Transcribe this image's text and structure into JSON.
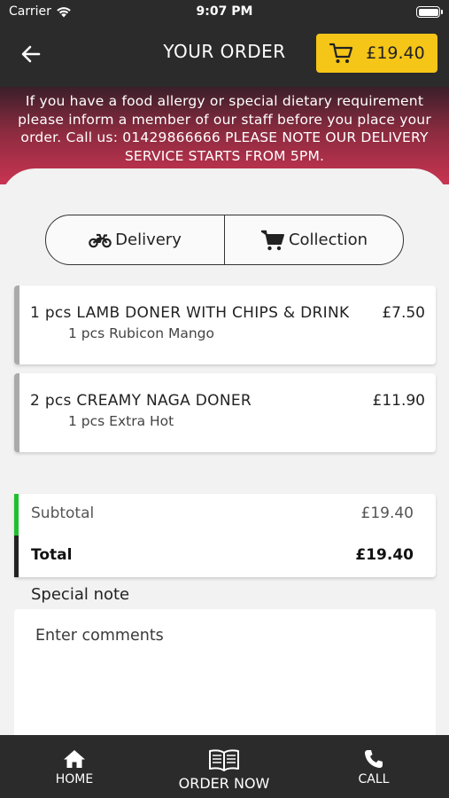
{
  "status_bar": {
    "carrier": "Carrier",
    "time": "9:07 PM"
  },
  "header": {
    "title": "YOUR ORDER",
    "cart_total": "£19.40",
    "back_icon": "arrow-left-icon",
    "cart_icon": "cart-icon"
  },
  "banner": {
    "text": "If you have a food allergy or special dietary requirement please inform a member of our staff before you place your order. Call us: 01429866666 PLEASE NOTE OUR DELIVERY SERVICE STARTS FROM 5PM."
  },
  "order_type": {
    "options": [
      {
        "label": "Delivery",
        "icon": "motorbike-icon"
      },
      {
        "label": "Collection",
        "icon": "cart-icon"
      }
    ]
  },
  "items": [
    {
      "name": "1 pcs LAMB DONER WITH CHIPS & DRINK",
      "price": "£7.50",
      "modifier": "1 pcs Rubicon Mango"
    },
    {
      "name": "2 pcs CREAMY NAGA DONER",
      "price": "£11.90",
      "modifier": "1 pcs Extra  Hot"
    }
  ],
  "totals": {
    "subtotal_label": "Subtotal",
    "subtotal_value": "£19.40",
    "total_label": "Total",
    "total_value": "£19.40"
  },
  "note": {
    "label": "Special note",
    "placeholder": "Enter comments"
  },
  "tabbar": {
    "home": "HOME",
    "order": "ORDER NOW",
    "call": "CALL"
  },
  "colors": {
    "header_bg": "#2b2b2b",
    "accent": "#f5c518",
    "subtotal_bar": "#1fbf2f",
    "banner_bottom": "#c93451"
  }
}
